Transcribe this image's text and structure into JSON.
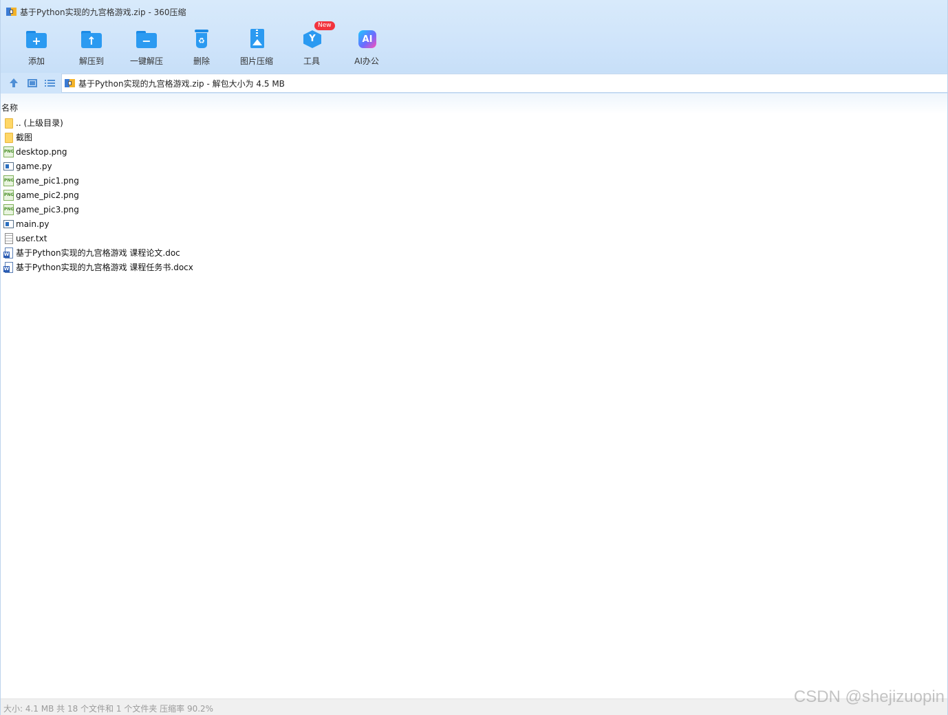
{
  "window": {
    "title": "基于Python实现的九宫格游戏.zip - 360压缩"
  },
  "toolbar": {
    "items": [
      {
        "label": "添加",
        "icon": "add-folder-icon"
      },
      {
        "label": "解压到",
        "icon": "extract-to-icon"
      },
      {
        "label": "一键解压",
        "icon": "one-click-extract-icon"
      },
      {
        "label": "删除",
        "icon": "recycle-bin-icon"
      },
      {
        "label": "图片压缩",
        "icon": "image-compress-icon"
      },
      {
        "label": "工具",
        "icon": "tools-cube-icon",
        "badge": "New"
      },
      {
        "label": "AI办公",
        "icon": "ai-office-icon"
      }
    ]
  },
  "address": {
    "text": "基于Python实现的九宫格游戏.zip - 解包大小为 4.5 MB"
  },
  "file_list": {
    "column_name": "名称",
    "rows": [
      {
        "name": ".. (上级目录)",
        "type": "folder"
      },
      {
        "name": "截图",
        "type": "folder"
      },
      {
        "name": "desktop.png",
        "type": "png"
      },
      {
        "name": "game.py",
        "type": "py"
      },
      {
        "name": "game_pic1.png",
        "type": "png"
      },
      {
        "name": "game_pic2.png",
        "type": "png"
      },
      {
        "name": "game_pic3.png",
        "type": "png"
      },
      {
        "name": "main.py",
        "type": "py"
      },
      {
        "name": "user.txt",
        "type": "txt"
      },
      {
        "name": "基于Python实现的九宫格游戏 课程论文.doc",
        "type": "doc"
      },
      {
        "name": "基于Python实现的九宫格游戏 课程任务书.docx",
        "type": "doc"
      }
    ]
  },
  "status": {
    "text": "大小: 4.1 MB 共 18 个文件和 1 个文件夹 压缩率 90.2%"
  },
  "watermark": "CSDN @shejizuopin",
  "colors": {
    "toolbar_bg": "#cfe4fa",
    "icon_blue": "#2b9af1",
    "badge_red": "#f2333d",
    "folder_yellow": "#ffd767",
    "status_text": "#9a9a9a"
  }
}
